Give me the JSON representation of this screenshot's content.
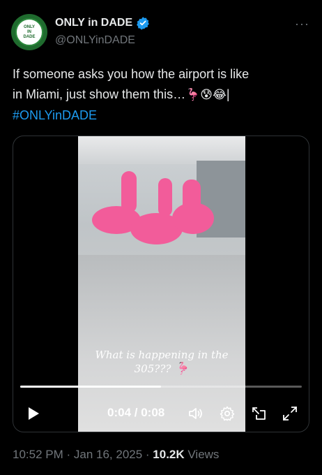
{
  "author": {
    "display_name": "ONLY in DADE",
    "handle": "@ONLYinDADE",
    "avatar_text": [
      "ONLY",
      "IN",
      "DADE"
    ],
    "verified_color": "#1d9bf0"
  },
  "more_label": "···",
  "tweet": {
    "text_line1": "If someone asks you how the airport is like",
    "text_line2": "in Miami, just show them this…",
    "emojis": "🦩😰😂",
    "trailing": "|",
    "hashtag": "#ONLYinDADE"
  },
  "video": {
    "caption_line1": "What is happening in the",
    "caption_line2": "305???",
    "caption_emoji": "🦩",
    "current_time": "0:04",
    "separator": " / ",
    "duration": "0:08",
    "progress": 0.5
  },
  "meta": {
    "time": "10:52 PM",
    "dot1": " · ",
    "date": "Jan 16, 2025",
    "dot2": " · ",
    "views_count": "10.2K",
    "views_label": " Views"
  },
  "colors": {
    "background": "#000000",
    "text": "#e7e9ea",
    "muted": "#71767b",
    "accent": "#1d9bf0",
    "flamingo": "#f25c9a"
  }
}
